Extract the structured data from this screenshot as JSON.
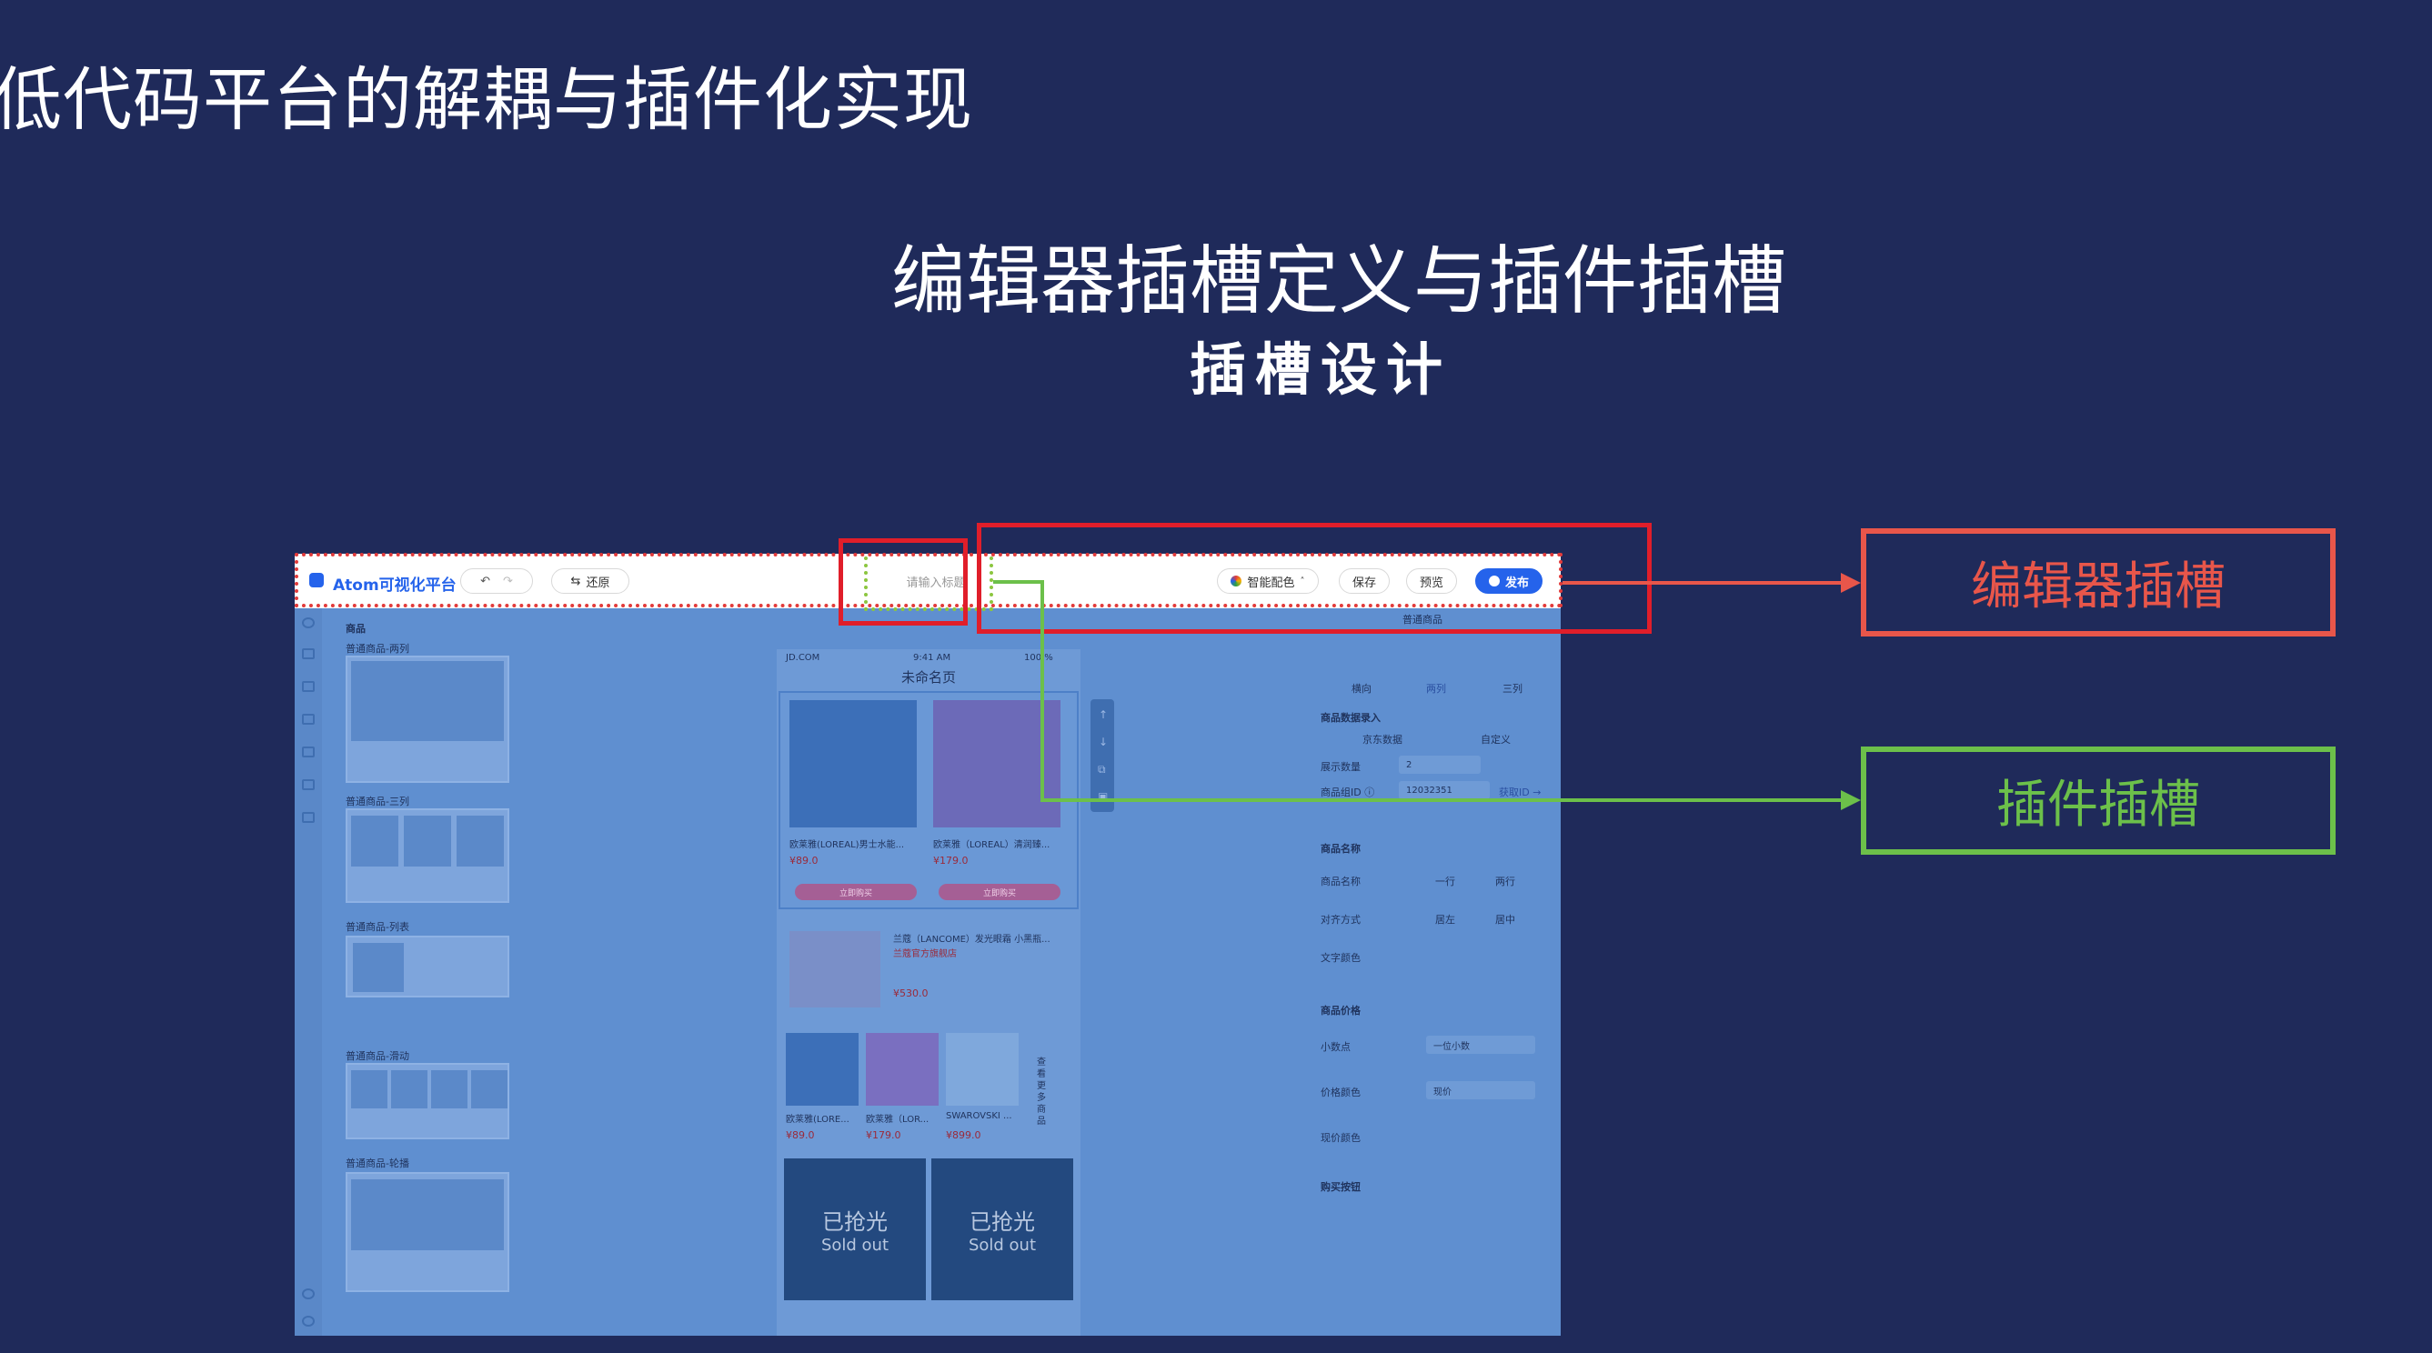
{
  "slide": {
    "title": "低代码平台的解耦与插件化实现",
    "section_title": "编辑器插槽定义与插件插槽",
    "section_subtitle": "插槽设计"
  },
  "editor": {
    "app_name": "Atom可视化平台",
    "restore_label": "还原",
    "title_placeholder": "请输入标题",
    "smart_color_label": "智能配色",
    "save_label": "保存",
    "preview_label": "预览",
    "publish_label": "发布",
    "left_panel": {
      "section": "商品",
      "categories": [
        "普通商品-两列",
        "普通商品-三列",
        "普通商品-列表",
        "普通商品-滑动",
        "普通商品-轮播"
      ]
    },
    "phone": {
      "status_carrier": "JD.COM",
      "status_time": "9:41 AM",
      "status_battery": "100 %",
      "page_title": "未命名页",
      "products": [
        {
          "name": "欧莱雅(LOREAL)男士水能...",
          "price": "¥89.0",
          "button": "立即购买"
        },
        {
          "name": "欧莱雅（LOREAL）清润臻...",
          "price": "¥179.0",
          "button": "立即购买"
        }
      ],
      "list_item": {
        "name": "兰蔻（LANCOME）发光眼霜 小黑瓶...",
        "shop": "兰蔻官方旗舰店",
        "price": "¥530.0"
      },
      "slide_items": [
        {
          "name": "欧莱雅(LORE...",
          "price": "¥89.0"
        },
        {
          "name": "欧莱雅（LOR...",
          "price": "¥179.0"
        },
        {
          "name": "SWAROVSKI ...",
          "price": "¥899.0"
        }
      ],
      "see_more": "查看更多商品",
      "sold_out_cn": "已抢光",
      "sold_out_en": "Sold out"
    },
    "right_panel": {
      "group_title": "普通商品",
      "layout_options": [
        "横向",
        "两列",
        "三列"
      ],
      "data_entry_title": "商品数据录入",
      "data_tabs": [
        "京东数据",
        "自定义"
      ],
      "display_count_label": "展示数量",
      "display_count_value": "2",
      "group_id_label": "商品组ID ⓘ",
      "group_id_value": "12032351",
      "group_id_action": "获取ID →",
      "name_title": "商品名称",
      "name_rows_label": "商品名称",
      "name_rows_options": [
        "一行",
        "两行"
      ],
      "align_label": "对齐方式",
      "align_options": [
        "居左",
        "居中"
      ],
      "text_color_label": "文字颜色",
      "price_title": "商品价格",
      "decimal_label": "小数点",
      "decimal_value": "一位小数",
      "price_type_label": "价格颜色",
      "price_type_value": "现价",
      "price_color_label": "现价颜色",
      "buy_button_title": "购买按钮"
    }
  },
  "callouts": {
    "editor_slot": "编辑器插槽",
    "plugin_slot": "插件插槽"
  },
  "colors": {
    "background": "#1f2a5a",
    "editor_slot": "#e8564a",
    "plugin_slot": "#6cc04a",
    "highlight_red": "#e01e2a",
    "brand_blue": "#2563eb"
  }
}
